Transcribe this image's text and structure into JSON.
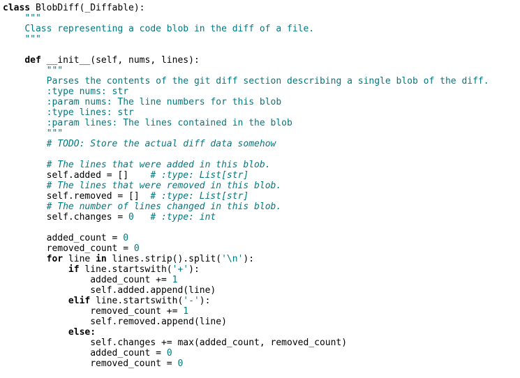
{
  "colors": {
    "background": "#ffffff",
    "default_text": "#000000",
    "teal_syntax": "#00797f"
  },
  "code": {
    "class_kw": "class",
    "class_sig": " BlobDiff(_Diffable):",
    "doc_quotes": "\"\"\"",
    "class_doc": "Class representing a code blob in the diff of a file.",
    "def_kw": "def",
    "def_sig": " __init__(self, nums, lines):",
    "init_doc_1": "Parses the contents of the git diff section describing a single blob of the diff.",
    "init_doc_2": ":type nums: str",
    "init_doc_3": ":param nums: The line numbers for this blob",
    "init_doc_4": ":type lines: str",
    "init_doc_5": ":param lines: The lines contained in the blob",
    "todo_comment": "# TODO: Store the actual diff data somehow",
    "cmt_added": "# The lines that were added in this blob.",
    "added_stmt": "self.added = []",
    "added_type": "# :type: List[str]",
    "cmt_removed": "# The lines that were removed in this blob.",
    "removed_stmt": "self.removed = []",
    "removed_type": "# :type: List[str]",
    "cmt_changes": "# The number of lines changed in this blob.",
    "changes_stmt": "self.changes = ",
    "changes_zero": "0",
    "changes_type": "# :type: int",
    "added_count_init": "added_count = ",
    "removed_count_init": "removed_count = ",
    "zero": "0",
    "one": "1",
    "for_kw": "for",
    "for_mid": " line ",
    "in_kw": "in",
    "for_rest": " lines.strip().split(",
    "newline_str": "'\\n'",
    "for_end": "):",
    "if_kw": "if",
    "startswith_call": " line.startswith(",
    "plus_str": "'+'",
    "call_end": "):",
    "added_inc": "added_count += ",
    "append_added": "self.added.append(line)",
    "elif_kw": "elif",
    "minus_str": "'-'",
    "removed_inc": "removed_count += ",
    "append_removed": "self.removed.append(line)",
    "else_kw": "else:",
    "changes_update": "self.changes += max(added_count, removed_count)",
    "added_reset": "added_count = ",
    "removed_reset": "removed_count = "
  }
}
